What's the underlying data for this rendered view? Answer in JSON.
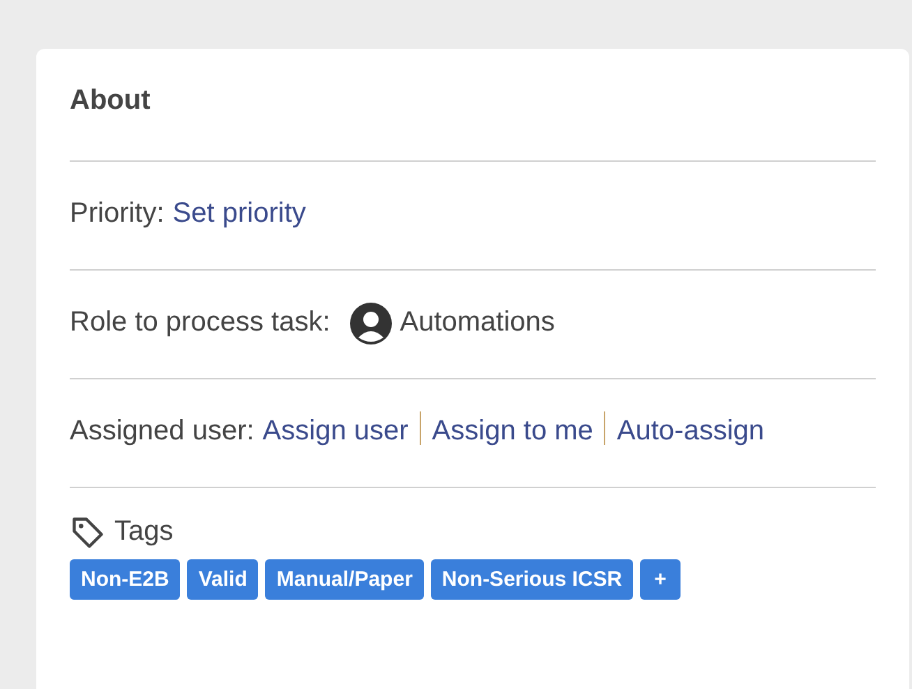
{
  "card": {
    "title": "About",
    "priority": {
      "label": "Priority:",
      "link": "Set priority"
    },
    "role": {
      "label": "Role to process task:",
      "value": "Automations"
    },
    "assigned_user": {
      "label": "Assigned user:",
      "links": [
        "Assign user",
        "Assign to me",
        "Auto-assign"
      ]
    },
    "tags": {
      "label": "Tags",
      "items": [
        "Non-E2B",
        "Valid",
        "Manual/Paper",
        "Non-Serious ICSR"
      ],
      "add_button": "+"
    }
  }
}
